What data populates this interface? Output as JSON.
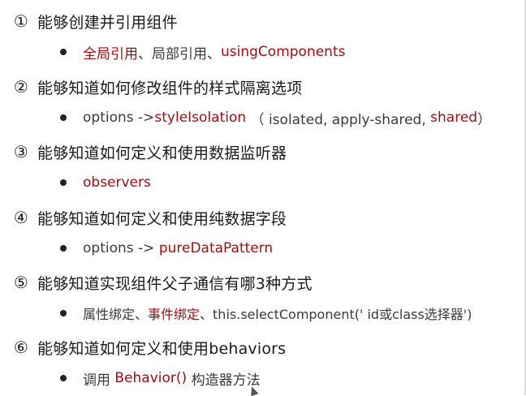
{
  "items": [
    {
      "number": "①",
      "title": "能够创建并引用组件",
      "bullet": [
        {
          "text": "全局引用",
          "highlight": true
        },
        {
          "text": "、局部引用、",
          "highlight": false
        },
        {
          "text": "usingComponents",
          "highlight": true
        }
      ]
    },
    {
      "number": "②",
      "title": "能够知道如何修改组件的样式隔离选项",
      "bullet": [
        {
          "text": "options -> ",
          "highlight": false
        },
        {
          "text": "styleIsolation",
          "highlight": true
        },
        {
          "text": " （ isolated, apply-shared, ",
          "highlight": false
        },
        {
          "text": "shared",
          "highlight": true
        },
        {
          "text": "）",
          "highlight": false
        }
      ]
    },
    {
      "number": "③",
      "title": "能够知道如何定义和使用数据监听器",
      "bullet": [
        {
          "text": "observers",
          "highlight": true
        }
      ]
    },
    {
      "number": "④",
      "title": "能够知道如何定义和使用纯数据字段",
      "bullet": [
        {
          "text": "options -> ",
          "highlight": false
        },
        {
          "text": "pureDataPattern",
          "highlight": true
        }
      ]
    },
    {
      "number": "⑤",
      "title": "能够知道实现组件父子通信有哪3种方式",
      "bullet": [
        {
          "text": "属性绑定、",
          "highlight": false
        },
        {
          "text": "事件绑定",
          "highlight": true
        },
        {
          "text": "、this.selectComponent(' id或class选择器')",
          "highlight": false
        }
      ]
    },
    {
      "number": "⑥",
      "title": "能够知道如何定义和使用behaviors",
      "bullet": [
        {
          "text": "调用 ",
          "highlight": false
        },
        {
          "text": "Behavior()",
          "highlight": true
        },
        {
          "text": " 构造器方法",
          "highlight": false
        }
      ]
    }
  ],
  "colors": {
    "highlight": "#a10d12",
    "text": "#1f1f1f",
    "muted": "#3a3a3a"
  }
}
